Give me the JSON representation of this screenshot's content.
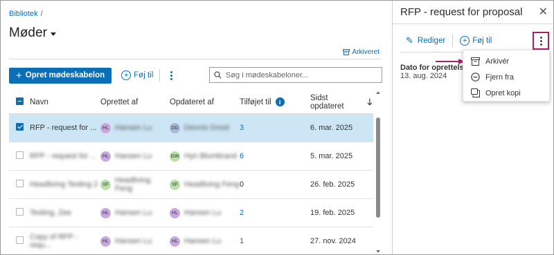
{
  "breadcrumb": {
    "root": "Bibliotek",
    "separator": "/"
  },
  "page": {
    "title": "Møder"
  },
  "archived_link": "Arkiveret",
  "toolbar": {
    "create_label": "Opret mødeskabelon",
    "add_to_label": "Føj til",
    "search_placeholder": "Søg i mødeskabeloner..."
  },
  "table": {
    "headers": {
      "name": "Navn",
      "created_by": "Oprettet af",
      "updated_by": "Opdateret af",
      "added_to": "Tilføjet til",
      "last_updated": "Sidst opdateret"
    },
    "rows": [
      {
        "name": "RFP - request for ...",
        "selected": true,
        "created_initials": "HL",
        "created_name": "Hansen Lu",
        "created_color": "#c9a8e0",
        "updated_initials": "DG",
        "updated_name": "Dennis Groot",
        "updated_color": "#a9b9dc",
        "added_to": "3",
        "last_updated": "6. mar. 2025"
      },
      {
        "name": "RFP - request for ...",
        "selected": false,
        "created_initials": "HL",
        "created_name": "Hansen Lu",
        "created_color": "#c9a8e0",
        "updated_initials": "GW",
        "updated_name": "Hyn Blumbrand",
        "updated_color": "#b9e0a8",
        "added_to": "6",
        "last_updated": "5. mar. 2025"
      },
      {
        "name": "Headliving Testing 2",
        "selected": false,
        "created_initials": "XF",
        "created_name": "Headliving Feng",
        "created_color": "#b9e0a8",
        "updated_initials": "XF",
        "updated_name": "Headliving Feng",
        "updated_color": "#b9e0a8",
        "added_to": "0",
        "last_updated": "26. feb. 2025"
      },
      {
        "name": "Testing, Zee",
        "selected": false,
        "created_initials": "HL",
        "created_name": "Hansen Lu",
        "created_color": "#c9a8e0",
        "updated_initials": "HL",
        "updated_name": "Hansen Lu",
        "updated_color": "#c9a8e0",
        "added_to": "2",
        "last_updated": "19. feb. 2025"
      },
      {
        "name": "Copy of RFP - requ...",
        "selected": false,
        "created_initials": "HL",
        "created_name": "Hansen Lu",
        "created_color": "#c9a8e0",
        "updated_initials": "HL",
        "updated_name": "Hansen Lu",
        "updated_color": "#c9a8e0",
        "added_to": "1",
        "last_updated": "27. nov. 2024"
      }
    ]
  },
  "panel": {
    "title": "RFP - request for proposal",
    "edit_label": "Rediger",
    "add_to_label": "Føj til",
    "date_label": "Dato for oprettelse",
    "date_value": "13. aug. 2024"
  },
  "menu": {
    "items": [
      {
        "label": "Arkivér",
        "icon": "archive-icon"
      },
      {
        "label": "Fjern fra",
        "icon": "remove-circle-icon"
      },
      {
        "label": "Opret kopi",
        "icon": "copy-icon"
      }
    ]
  },
  "colors": {
    "accent": "#0a6fb7",
    "selected_row": "#cde6f5",
    "highlight": "#a8206c"
  }
}
